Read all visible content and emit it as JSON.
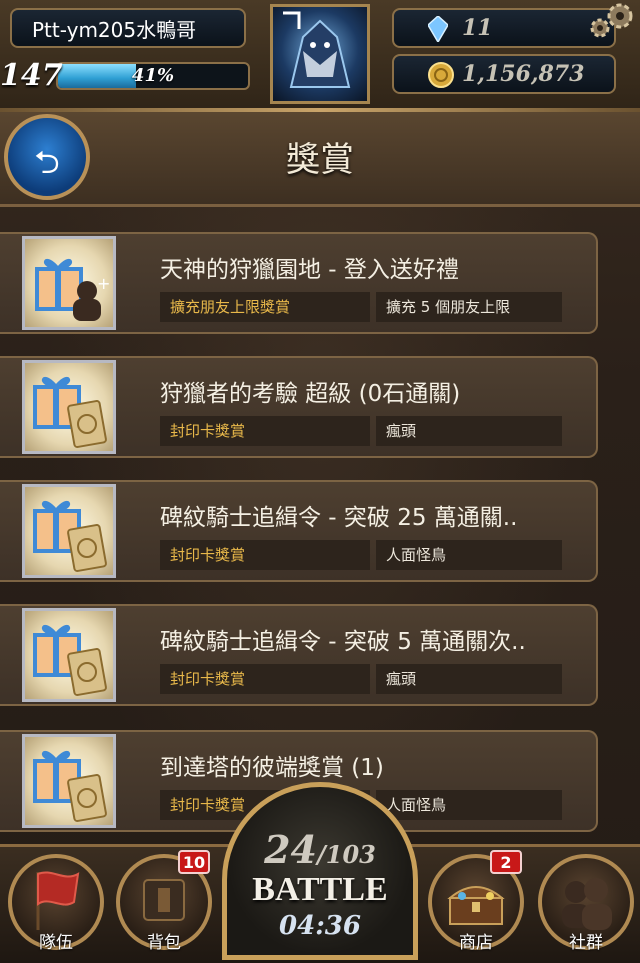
{
  "player": {
    "name": "Ptt-ym205水鴨哥",
    "level": "147",
    "xp_percent_text": "41%",
    "xp_fraction": 0.41
  },
  "currency": {
    "gems": "11",
    "coins": "1,156,873"
  },
  "page": {
    "title": "獎賞"
  },
  "rewards": [
    {
      "title": "天神的狩獵園地 - 登入送好禮",
      "tag": "擴充朋友上限獎賞",
      "desc": "擴充 5 個朋友上限",
      "icon": "gift-friend-icon"
    },
    {
      "title": "狩獵者的考驗 超級 (0石通關)",
      "tag": "封印卡獎賞",
      "desc": "瘋頭",
      "icon": "gift-card-icon"
    },
    {
      "title": "碑紋騎士追緝令 - 突破 25 萬通關..",
      "tag": "封印卡獎賞",
      "desc": "人面怪鳥",
      "icon": "gift-card-icon"
    },
    {
      "title": "碑紋騎士追緝令 - 突破 5 萬通關次..",
      "tag": "封印卡獎賞",
      "desc": "瘋頭",
      "icon": "gift-card-icon"
    },
    {
      "title": "到達塔的彼端獎賞 (1)",
      "tag": "封印卡獎賞",
      "desc": "人面怪鳥",
      "icon": "gift-card-icon"
    }
  ],
  "battle": {
    "stamina_current": "24",
    "stamina_max": "/103",
    "label": "BATTLE",
    "timer": "04:36"
  },
  "nav": {
    "team": {
      "label": "隊伍"
    },
    "backpack": {
      "label": "背包",
      "badge": "10"
    },
    "shop": {
      "label": "商店",
      "badge": "2"
    },
    "social": {
      "label": "社群"
    }
  },
  "colors": {
    "accent_gold": "#c9a05a",
    "tag_text": "#e8b84a",
    "xp_blue": "#2e9fd3",
    "badge_red": "#c81818"
  }
}
